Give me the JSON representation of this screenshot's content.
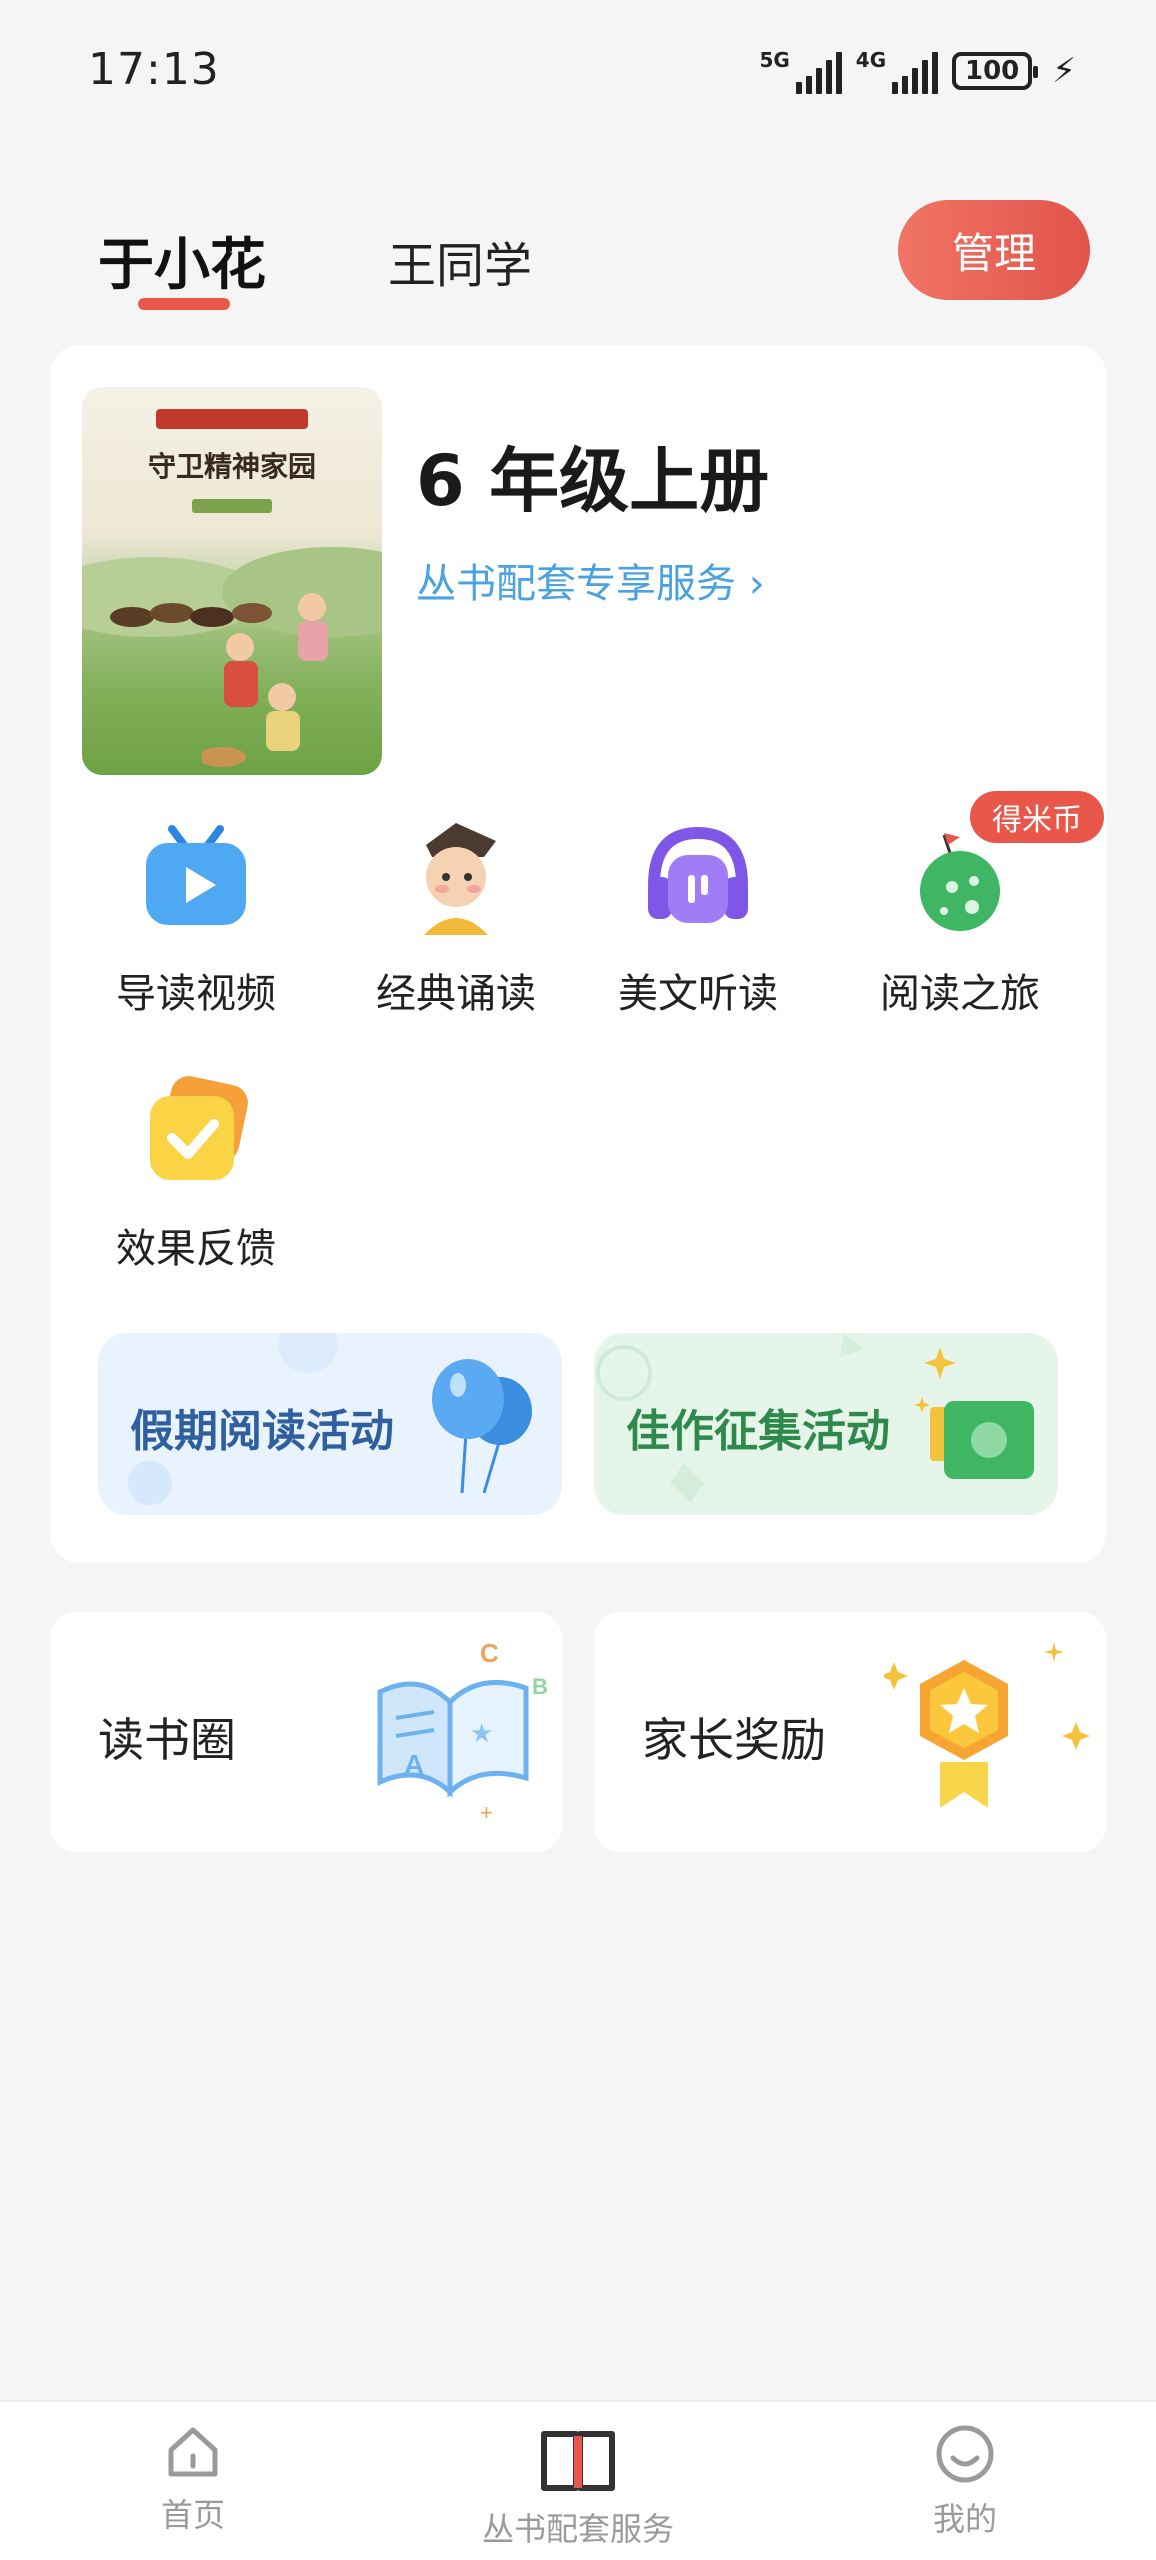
{
  "status_bar": {
    "time": "17:13",
    "network_1": "5G",
    "network_2": "4G",
    "battery": "100",
    "charging_icon": "bolt-icon"
  },
  "profiles": {
    "active": "于小花",
    "inactive": "王同学",
    "manage_label": "管理"
  },
  "book": {
    "cover_title": "守卫精神家园",
    "grade": "6 年级上册",
    "service_link": "丛书配套专享服务 ›"
  },
  "features": [
    {
      "label": "导读视频",
      "icon": "tv-play-icon"
    },
    {
      "label": "经典诵读",
      "icon": "scholar-character-icon"
    },
    {
      "label": "美文听读",
      "icon": "headphones-icon"
    },
    {
      "label": "阅读之旅",
      "icon": "planet-journey-icon",
      "badge": "得米币"
    },
    {
      "label": "效果反馈",
      "icon": "check-card-icon"
    }
  ],
  "activities": {
    "holiday": "假期阅读活动",
    "contest": "佳作征集活动"
  },
  "cards": {
    "reading_circle": "读书圈",
    "parent_reward": "家长奖励"
  },
  "bottom_nav": [
    {
      "label": "首页",
      "icon": "home-icon"
    },
    {
      "label": "丛书配套服务",
      "icon": "open-book-icon"
    },
    {
      "label": "我的",
      "icon": "smile-profile-icon"
    }
  ],
  "colors": {
    "accent": "#e8574a",
    "link": "#4aa3e0",
    "holiday_text": "#2f5f9e",
    "contest_text": "#2e8a4a"
  }
}
